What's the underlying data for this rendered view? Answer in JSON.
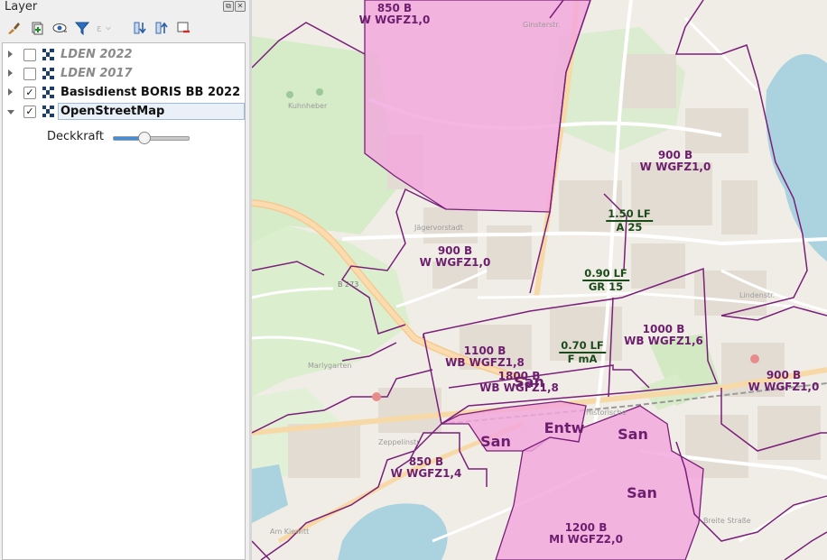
{
  "panel": {
    "title": "Layer",
    "buttons": {
      "float": "⧉",
      "close": "✕"
    },
    "toolbar": [
      {
        "name": "style-manager-icon",
        "glyph": "🖌"
      },
      {
        "name": "add-group-icon",
        "glyph": "⊞"
      },
      {
        "name": "visibility-icon",
        "glyph": "👁"
      },
      {
        "name": "filter-icon",
        "glyph": "▼"
      },
      {
        "name": "expression-filter-icon",
        "glyph": "ε"
      },
      {
        "name": "expand-all-icon",
        "glyph": "⇊"
      },
      {
        "name": "collapse-all-icon",
        "glyph": "⇈"
      },
      {
        "name": "remove-layer-icon",
        "glyph": "⊟"
      }
    ],
    "layers": [
      {
        "name": "LDEN 2022",
        "checked": false,
        "style": "grey",
        "expanded": false
      },
      {
        "name": "LDEN 2017",
        "checked": false,
        "style": "grey",
        "expanded": false
      },
      {
        "name": "Basisdienst BORIS BB 2022",
        "checked": true,
        "style": "bold",
        "expanded": false
      },
      {
        "name": "OpenStreetMap",
        "checked": true,
        "style": "bold",
        "expanded": true
      }
    ],
    "opacity": {
      "label": "Deckkraft",
      "value": 0.4
    }
  },
  "map": {
    "zone_color": "#6d1e6e",
    "zone_fill": "#f0a8dc",
    "labels": [
      {
        "id": "z850-top",
        "v1": "850 B",
        "v2": "W WGFZ1,0",
        "kind": "zone"
      },
      {
        "id": "z900-ne",
        "v1": "900 B",
        "v2": "W WGFZ1,0",
        "kind": "zone"
      },
      {
        "id": "z150-lf",
        "v1": "1.50 LF",
        "v2": "A  25",
        "kind": "green"
      },
      {
        "id": "z900-mid",
        "v1": "900 B",
        "v2": "W WGFZ1,0",
        "kind": "zone"
      },
      {
        "id": "z090-lf",
        "v1": "0.90 LF",
        "v2": "GR  15",
        "kind": "green"
      },
      {
        "id": "z1000",
        "v1": "1000 B",
        "v2": "WB WGFZ1,6",
        "kind": "zone"
      },
      {
        "id": "z070-lf",
        "v1": "0.70 LF",
        "v2": "F  mA",
        "kind": "green"
      },
      {
        "id": "z1100",
        "v1": "1100 B",
        "v2": "WB WGFZ1,8",
        "kind": "zone"
      },
      {
        "id": "z1800",
        "v1": "1800 B",
        "v2": "WB WGFZ1,8",
        "kind": "zone"
      },
      {
        "id": "z900-e",
        "v1": "900 B",
        "v2": "W WGFZ1,0",
        "kind": "zone"
      },
      {
        "id": "z850-sw",
        "v1": "850 B",
        "v2": "W WGFZ1,4",
        "kind": "zone"
      },
      {
        "id": "z1200",
        "v1": "1200 B",
        "v2": "MI WGFZ2,0",
        "kind": "zone"
      },
      {
        "id": "san-1",
        "v1": "San",
        "v2": "",
        "kind": "big"
      },
      {
        "id": "san-2",
        "v1": "San",
        "v2": "",
        "kind": "big"
      },
      {
        "id": "san-3",
        "v1": "San",
        "v2": "",
        "kind": "big"
      },
      {
        "id": "san-4",
        "v1": "San",
        "v2": "",
        "kind": "big"
      },
      {
        "id": "entw",
        "v1": "Entw",
        "v2": "",
        "kind": "big"
      }
    ]
  }
}
